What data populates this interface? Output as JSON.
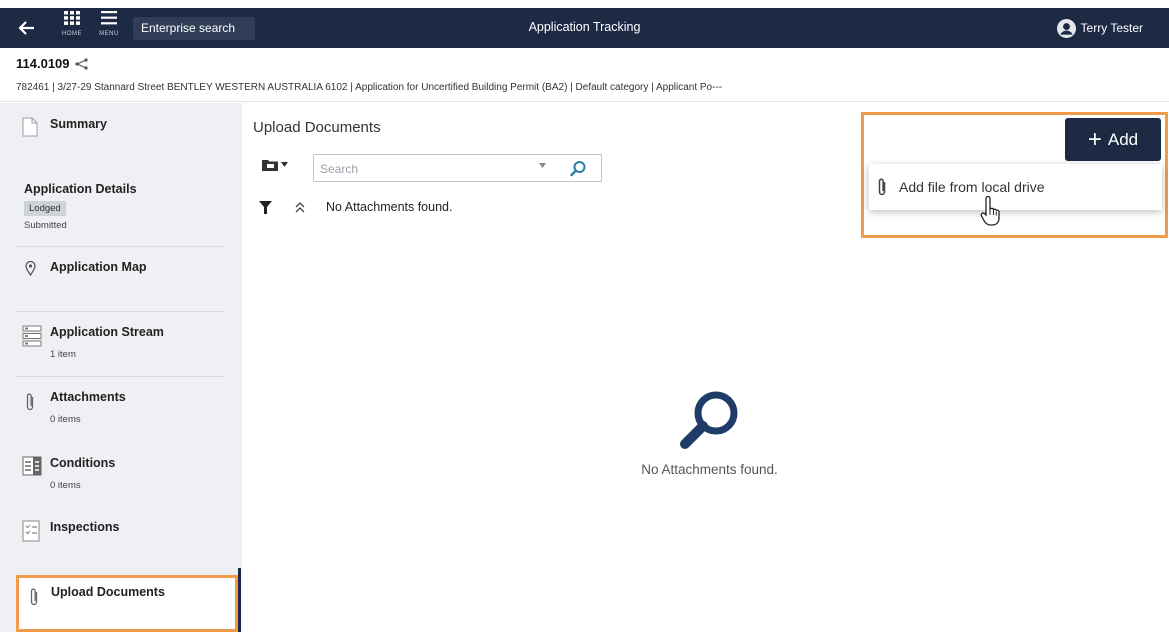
{
  "topbar": {
    "home_caption": "HOME",
    "menu_caption": "MENU",
    "search_label": "Enterprise search",
    "title": "Application Tracking",
    "user_name": "Terry Tester"
  },
  "application": {
    "number": "114.0109",
    "address_line": "782461 | 3/27-29 Stannard Street BENTLEY WESTERN AUSTRALIA 6102 | Application for Uncertified Building Permit (BA2) | Default category | Applicant Po---"
  },
  "sidebar": {
    "summary": "Summary",
    "details": {
      "label": "Application Details",
      "badge": "Lodged",
      "status": "Submitted"
    },
    "map": "Application Map",
    "stream": {
      "label": "Application Stream",
      "count": "1 item"
    },
    "attachments": {
      "label": "Attachments",
      "count": "0 items"
    },
    "conditions": {
      "label": "Conditions",
      "count": "0 items"
    },
    "inspections": "Inspections",
    "upload": "Upload Documents"
  },
  "main": {
    "title": "Upload Documents",
    "search_placeholder": "Search",
    "no_attachments_small": "No Attachments found.",
    "no_attachments_big": "No Attachments found."
  },
  "add_menu": {
    "button_label": "Add",
    "item_label": "Add file from local drive"
  },
  "colors": {
    "navy": "#1c2a44",
    "highlight": "#f29b4b"
  }
}
